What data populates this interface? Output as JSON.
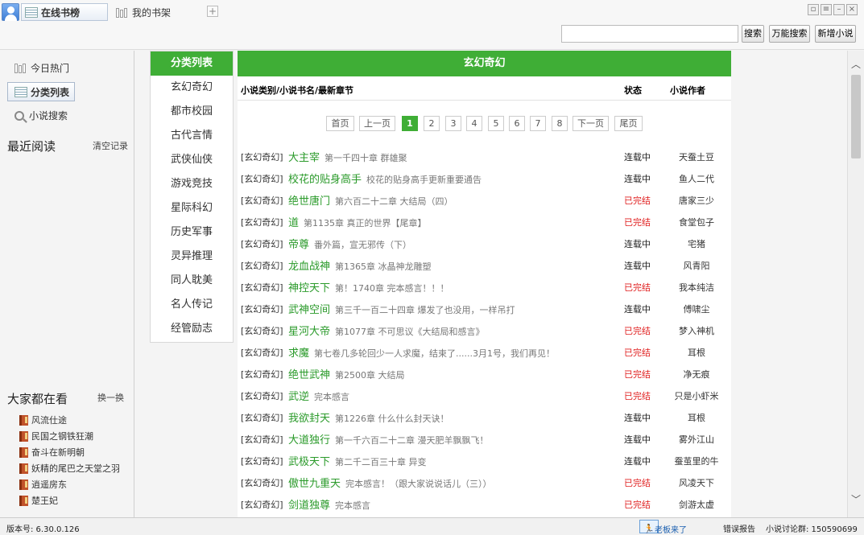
{
  "topbar": {
    "tab_online": "在线书榜",
    "tab_shelf": "我的书架",
    "plus": "+",
    "search_placeholder": "",
    "btn_search": "搜索",
    "btn_universal": "万能搜索",
    "btn_add": "新增小说"
  },
  "sidebar": {
    "today_hot": "今日热门",
    "category_list": "分类列表",
    "novel_search": "小说搜索",
    "recent_title": "最近阅读",
    "clear_history": "清空记录",
    "everyone_title": "大家都在看",
    "refresh": "换一换",
    "hot_books": [
      "风流仕途",
      "民国之钢铁狂潮",
      "奋斗在新明朝",
      "妖精的尾巴之天堂之羽",
      "逍遥房东",
      "楚王妃"
    ]
  },
  "categories": {
    "header": "分类列表",
    "items": [
      "玄幻奇幻",
      "都市校园",
      "古代言情",
      "武侠仙侠",
      "游戏竞技",
      "星际科幻",
      "历史军事",
      "灵异推理",
      "同人耽美",
      "名人传记",
      "经管励志"
    ]
  },
  "main": {
    "header": "玄幻奇幻",
    "col_title": "小说类别/小说书名/最新章节",
    "col_status": "状态",
    "col_author": "小说作者",
    "pager": {
      "first": "首页",
      "prev": "上一页",
      "pages": [
        "1",
        "2",
        "3",
        "4",
        "5",
        "6",
        "7",
        "8"
      ],
      "next": "下一页",
      "last": "尾页",
      "current": "1"
    },
    "rows": [
      {
        "cat": "[玄幻奇幻]",
        "title": "大主宰",
        "chapter": "第一千四十章 群雄聚",
        "status": "连载中",
        "done": false,
        "author": "天蚕土豆"
      },
      {
        "cat": "[玄幻奇幻]",
        "title": "校花的贴身高手",
        "chapter": "校花的贴身高手更新重要通告",
        "status": "连载中",
        "done": false,
        "author": "鱼人二代"
      },
      {
        "cat": "[玄幻奇幻]",
        "title": "绝世唐门",
        "chapter": "第六百二十二章 大结局（四）",
        "status": "已完结",
        "done": true,
        "author": "唐家三少"
      },
      {
        "cat": "[玄幻奇幻]",
        "title": "道",
        "chapter": "第1135章 真正的世界【尾章】",
        "status": "已完结",
        "done": true,
        "author": "食堂包子"
      },
      {
        "cat": "[玄幻奇幻]",
        "title": "帝尊",
        "chapter": "番外篇，宣无邪传（下）",
        "status": "连载中",
        "done": false,
        "author": "宅猪"
      },
      {
        "cat": "[玄幻奇幻]",
        "title": "龙血战神",
        "chapter": "第1365章 冰晶神龙雕塑",
        "status": "连载中",
        "done": false,
        "author": "风青阳"
      },
      {
        "cat": "[玄幻奇幻]",
        "title": "神控天下",
        "chapter": "第！1740章 完本感言！！！",
        "status": "已完结",
        "done": true,
        "author": "我本纯洁"
      },
      {
        "cat": "[玄幻奇幻]",
        "title": "武神空间",
        "chapter": "第三千一百二十四章 爆发了也没用，一样吊打",
        "status": "连载中",
        "done": false,
        "author": "傅啸尘"
      },
      {
        "cat": "[玄幻奇幻]",
        "title": "星河大帝",
        "chapter": "第1077章 不可思议《大结局和感言》",
        "status": "已完结",
        "done": true,
        "author": "梦入神机"
      },
      {
        "cat": "[玄幻奇幻]",
        "title": "求魔",
        "chapter": "第七卷几多轮回少一人求魔，结束了......3月1号，我们再见！",
        "status": "已完结",
        "done": true,
        "author": "耳根"
      },
      {
        "cat": "[玄幻奇幻]",
        "title": "绝世武神",
        "chapter": "第2500章 大结局",
        "status": "已完结",
        "done": true,
        "author": "净无痕"
      },
      {
        "cat": "[玄幻奇幻]",
        "title": "武逆",
        "chapter": "完本感言",
        "status": "已完结",
        "done": true,
        "author": "只是小虾米"
      },
      {
        "cat": "[玄幻奇幻]",
        "title": "我欲封天",
        "chapter": "第1226章 什么什么封天诀！",
        "status": "连载中",
        "done": false,
        "author": "耳根"
      },
      {
        "cat": "[玄幻奇幻]",
        "title": "大道独行",
        "chapter": "第一千六百二十二章 漫天肥羊飘飘飞！",
        "status": "连载中",
        "done": false,
        "author": "雾外江山"
      },
      {
        "cat": "[玄幻奇幻]",
        "title": "武极天下",
        "chapter": "第二千二百三十章 异变",
        "status": "连载中",
        "done": false,
        "author": "蚕茧里的牛"
      },
      {
        "cat": "[玄幻奇幻]",
        "title": "傲世九重天",
        "chapter": "完本感言！（跟大家说说话儿（三））",
        "status": "已完结",
        "done": true,
        "author": "风凌天下"
      },
      {
        "cat": "[玄幻奇幻]",
        "title": "剑道独尊",
        "chapter": "完本感言",
        "status": "已完结",
        "done": true,
        "author": "剑游太虚"
      }
    ]
  },
  "statusbar": {
    "version": "版本号: 6.30.0.126",
    "old_version": "老板来了CTRL+H",
    "report": "错误报告",
    "discussion": "小说讨论群: 150590699"
  },
  "colors": {
    "accent": "#3fae36",
    "done": "#e02020",
    "link": "#2a9a2a"
  }
}
